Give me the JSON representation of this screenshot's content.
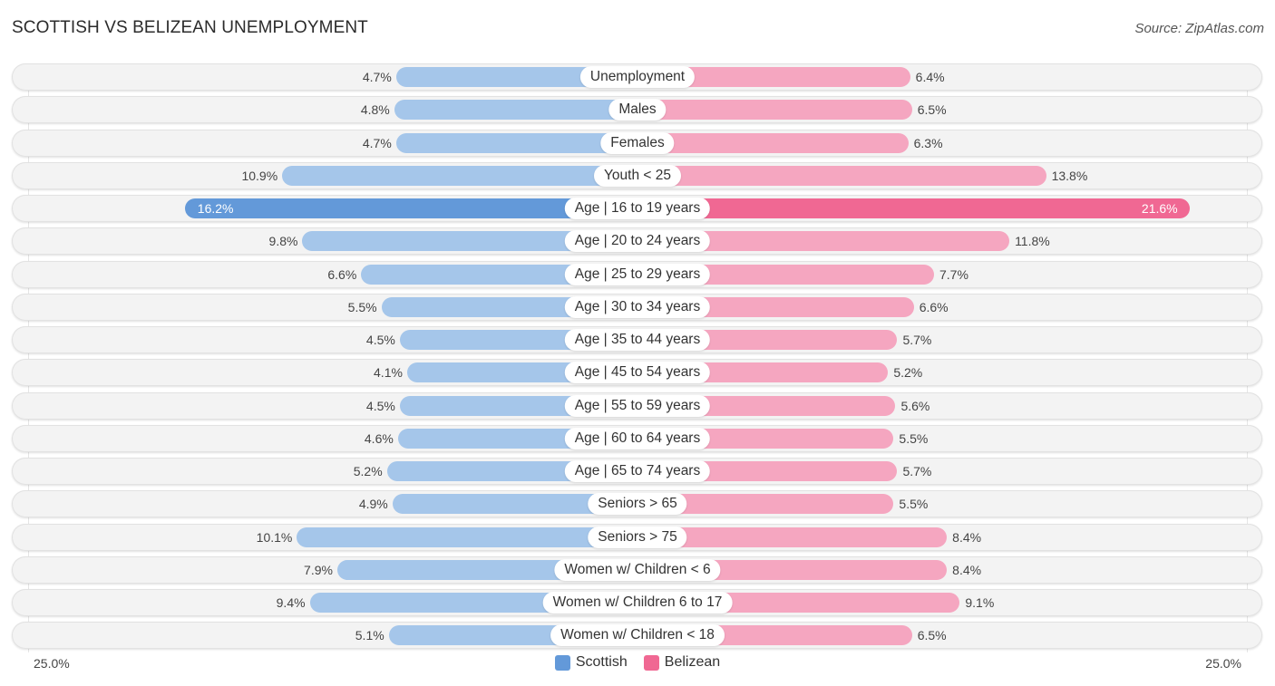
{
  "header": {
    "title": "SCOTTISH VS BELIZEAN UNEMPLOYMENT",
    "source": "Source: ZipAtlas.com"
  },
  "colors": {
    "scottish": "#a5c6ea",
    "scottish_highlight": "#6399d9",
    "belizean": "#f5a6c0",
    "belizean_highlight": "#f06893",
    "legend_scottish": "#6399d9",
    "legend_belizean": "#f06893"
  },
  "chart_data": {
    "type": "bar",
    "orientation": "horizontal-diverging",
    "title": "SCOTTISH VS BELIZEAN UNEMPLOYMENT",
    "source": "Source: ZipAtlas.com",
    "categories": [
      "Unemployment",
      "Males",
      "Females",
      "Youth < 25",
      "Age | 16 to 19 years",
      "Age | 20 to 24 years",
      "Age | 25 to 29 years",
      "Age | 30 to 34 years",
      "Age | 35 to 44 years",
      "Age | 45 to 54 years",
      "Age | 55 to 59 years",
      "Age | 60 to 64 years",
      "Age | 65 to 74 years",
      "Seniors > 65",
      "Seniors > 75",
      "Women w/ Children < 6",
      "Women w/ Children 6 to 17",
      "Women w/ Children < 18"
    ],
    "series": [
      {
        "name": "Scottish",
        "side": "left",
        "values": [
          4.7,
          4.8,
          4.7,
          10.9,
          16.2,
          9.8,
          6.6,
          5.5,
          4.5,
          4.1,
          4.5,
          4.6,
          5.2,
          4.9,
          10.1,
          7.9,
          9.4,
          5.1
        ],
        "labels": [
          "4.7%",
          "4.8%",
          "4.7%",
          "10.9%",
          "16.2%",
          "9.8%",
          "6.6%",
          "5.5%",
          "4.5%",
          "4.1%",
          "4.5%",
          "4.6%",
          "5.2%",
          "4.9%",
          "10.1%",
          "7.9%",
          "9.4%",
          "5.1%"
        ]
      },
      {
        "name": "Belizean",
        "side": "right",
        "values": [
          6.4,
          6.5,
          6.3,
          13.8,
          21.6,
          11.8,
          7.7,
          6.6,
          5.7,
          5.2,
          5.6,
          5.5,
          5.7,
          5.5,
          8.4,
          8.4,
          9.1,
          6.5
        ],
        "labels": [
          "6.4%",
          "6.5%",
          "6.3%",
          "13.8%",
          "21.6%",
          "11.8%",
          "7.7%",
          "6.6%",
          "5.7%",
          "5.2%",
          "5.6%",
          "5.5%",
          "5.7%",
          "5.5%",
          "8.4%",
          "8.4%",
          "9.1%",
          "6.5%"
        ]
      }
    ],
    "highlight_index": 4,
    "axis": {
      "left_label": "25.0%",
      "right_label": "25.0%",
      "max": 25.0
    },
    "legend": {
      "placement": "bottom-center",
      "items": [
        "Scottish",
        "Belizean"
      ]
    },
    "grid": false
  }
}
